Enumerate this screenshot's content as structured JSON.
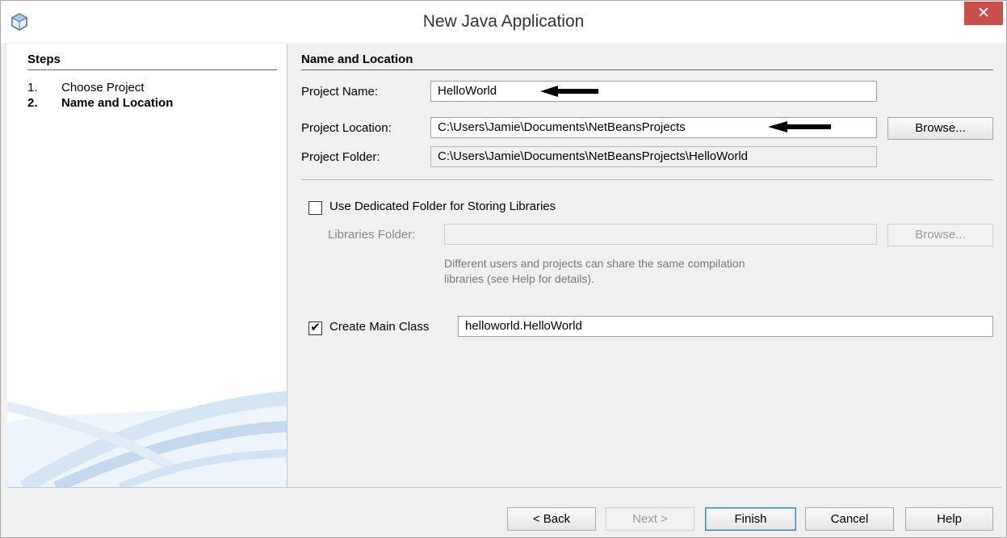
{
  "window": {
    "title": "New Java Application",
    "close_glyph": "✕",
    "icon": "netbeans-cube-icon"
  },
  "steps": {
    "title": "Steps",
    "items": [
      {
        "number": "1.",
        "label": "Choose Project"
      },
      {
        "number": "2.",
        "label": "Name and Location"
      }
    ]
  },
  "form": {
    "section_title": "Name and Location",
    "project_name": {
      "label": "Project Name:",
      "value": "HelloWorld"
    },
    "project_location": {
      "label": "Project Location:",
      "value": "C:\\Users\\Jamie\\Documents\\NetBeansProjects",
      "browse_label": "Browse..."
    },
    "project_folder": {
      "label": "Project Folder:",
      "value": "C:\\Users\\Jamie\\Documents\\NetBeansProjects\\HelloWorld"
    },
    "dedicated_folder": {
      "label": "Use Dedicated Folder for Storing Libraries",
      "checked": false
    },
    "libraries_folder": {
      "label": "Libraries Folder:",
      "value": "",
      "browse_label": "Browse..."
    },
    "libraries_help": {
      "line1": "Different users and projects can share the same compilation",
      "line2": "libraries (see Help for details)."
    },
    "create_main_class": {
      "label": "Create Main Class",
      "checked": true,
      "check_glyph": "✔",
      "value": "helloworld.HelloWorld"
    }
  },
  "buttons": {
    "back": "< Back",
    "next": "Next >",
    "finish": "Finish",
    "cancel": "Cancel",
    "help": "Help"
  },
  "colors": {
    "close_button": "#c7504b",
    "default_button_border": "#3c7fb1"
  }
}
